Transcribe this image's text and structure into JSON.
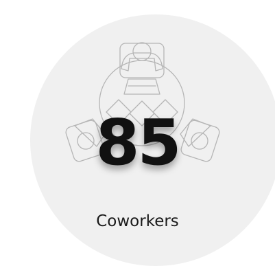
{
  "stat": {
    "value": "85",
    "label": "Coworkers"
  },
  "illustration": {
    "icon": "team-table-icon"
  },
  "colors": {
    "circle_background": "#f0f0f0",
    "line_art": "#b5b5b5",
    "number_text": "#111111",
    "label_text": "#1a1a1a"
  }
}
